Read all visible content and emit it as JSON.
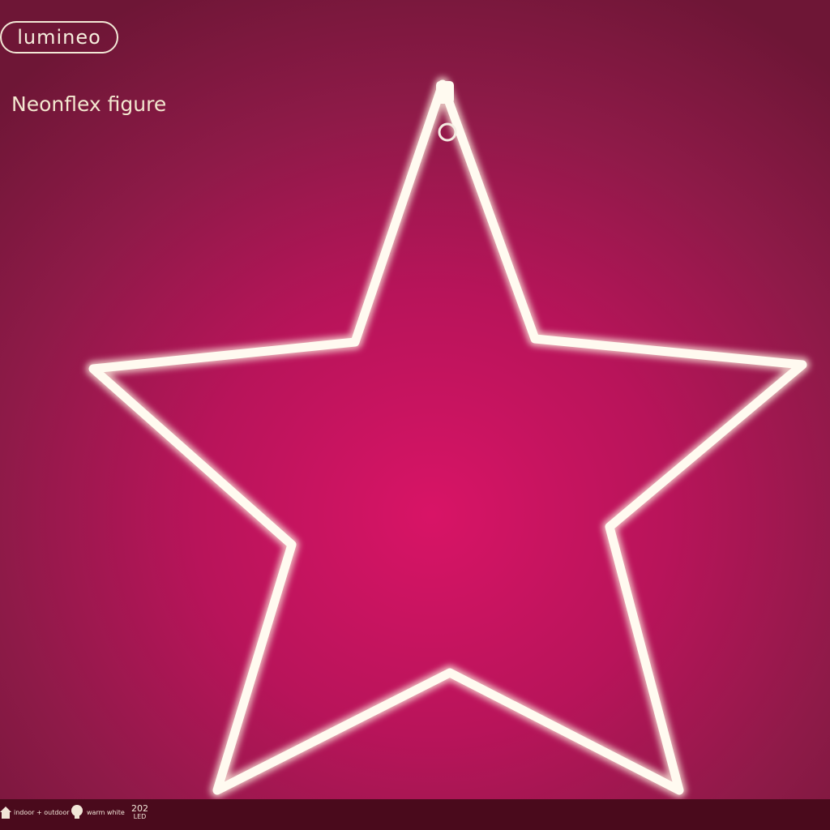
{
  "brand": {
    "name": "lumineo"
  },
  "product": {
    "title": "Neonflex figure"
  },
  "colors": {
    "glow": "#fff6e6",
    "tube": "#fffaf0",
    "background_center": "#d81466",
    "background_edge": "#6e1636"
  },
  "footer": {
    "features": [
      {
        "icon": "house-icon",
        "label": "indoor + outdoor"
      },
      {
        "icon": "bulb-icon",
        "label": "warm white"
      }
    ],
    "led_count": "202",
    "led_unit": "LED"
  }
}
